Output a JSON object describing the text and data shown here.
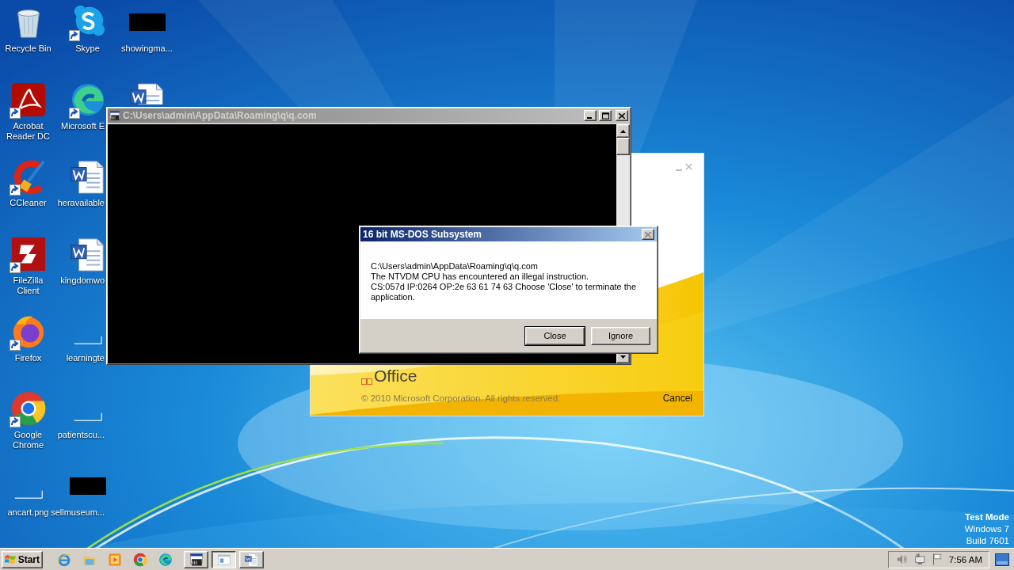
{
  "desktop_icons": [
    {
      "label": "Recycle Bin",
      "kind": "recycle",
      "shortcut": false
    },
    {
      "label": "Acrobat Reader DC",
      "kind": "acrobat",
      "shortcut": true
    },
    {
      "label": "CCleaner",
      "kind": "ccleaner",
      "shortcut": true
    },
    {
      "label": "FileZilla Client",
      "kind": "filezilla",
      "shortcut": true
    },
    {
      "label": "Firefox",
      "kind": "firefox",
      "shortcut": true
    },
    {
      "label": "Google Chrome",
      "kind": "chrome",
      "shortcut": true
    },
    {
      "label": "ancart.png",
      "kind": "blank",
      "shortcut": false
    },
    {
      "label": "Skype",
      "kind": "skype",
      "shortcut": true
    },
    {
      "label": "Microsoft E",
      "kind": "edge",
      "shortcut": true
    },
    {
      "label": "heravailable",
      "kind": "word",
      "shortcut": false
    },
    {
      "label": "kingdomwo",
      "kind": "word",
      "shortcut": false
    },
    {
      "label": "learningte",
      "kind": "blank",
      "shortcut": false
    },
    {
      "label": "patientscu...",
      "kind": "blank",
      "shortcut": false
    },
    {
      "label": "sellmuseum...",
      "kind": "redacted",
      "shortcut": false
    },
    {
      "label": "showingma...",
      "kind": "redacted",
      "shortcut": false
    },
    {
      "kind": "word",
      "shortcut": false
    }
  ],
  "office_splash": {
    "logo_text": "Office",
    "copyright": "© 2010 Microsoft Corporation.  All rights reserved.",
    "cancel": "Cancel"
  },
  "console_window": {
    "title": "C:\\Users\\admin\\AppData\\Roaming\\q\\q.com",
    "active": false
  },
  "dialog": {
    "title": "16 bit MS-DOS Subsystem",
    "active": true,
    "lines": [
      "C:\\Users\\admin\\AppData\\Roaming\\q\\q.com",
      "The NTVDM CPU has encountered an illegal instruction.",
      "CS:057d IP:0264 OP:2e 63 61 74 63 Choose 'Close' to terminate the application."
    ],
    "buttons": [
      {
        "label": "Close",
        "default": true
      },
      {
        "label": "Ignore",
        "default": false
      }
    ]
  },
  "system_notice": [
    "Test Mode",
    "Windows 7",
    "Build 7601"
  ],
  "taskbar": {
    "start": "Start",
    "quick_launch": [
      {
        "kind": "ie"
      },
      {
        "kind": "explorer"
      },
      {
        "kind": "media"
      },
      {
        "kind": "chrome"
      },
      {
        "kind": "edge"
      }
    ],
    "tasks": [
      {
        "kind": "console",
        "selected": false
      },
      {
        "kind": "dialog",
        "selected": true
      },
      {
        "kind": "word",
        "selected": false
      }
    ],
    "tray": [
      {
        "kind": "volume"
      },
      {
        "kind": "network"
      },
      {
        "kind": "flag"
      }
    ],
    "clock": "7:56 AM"
  }
}
